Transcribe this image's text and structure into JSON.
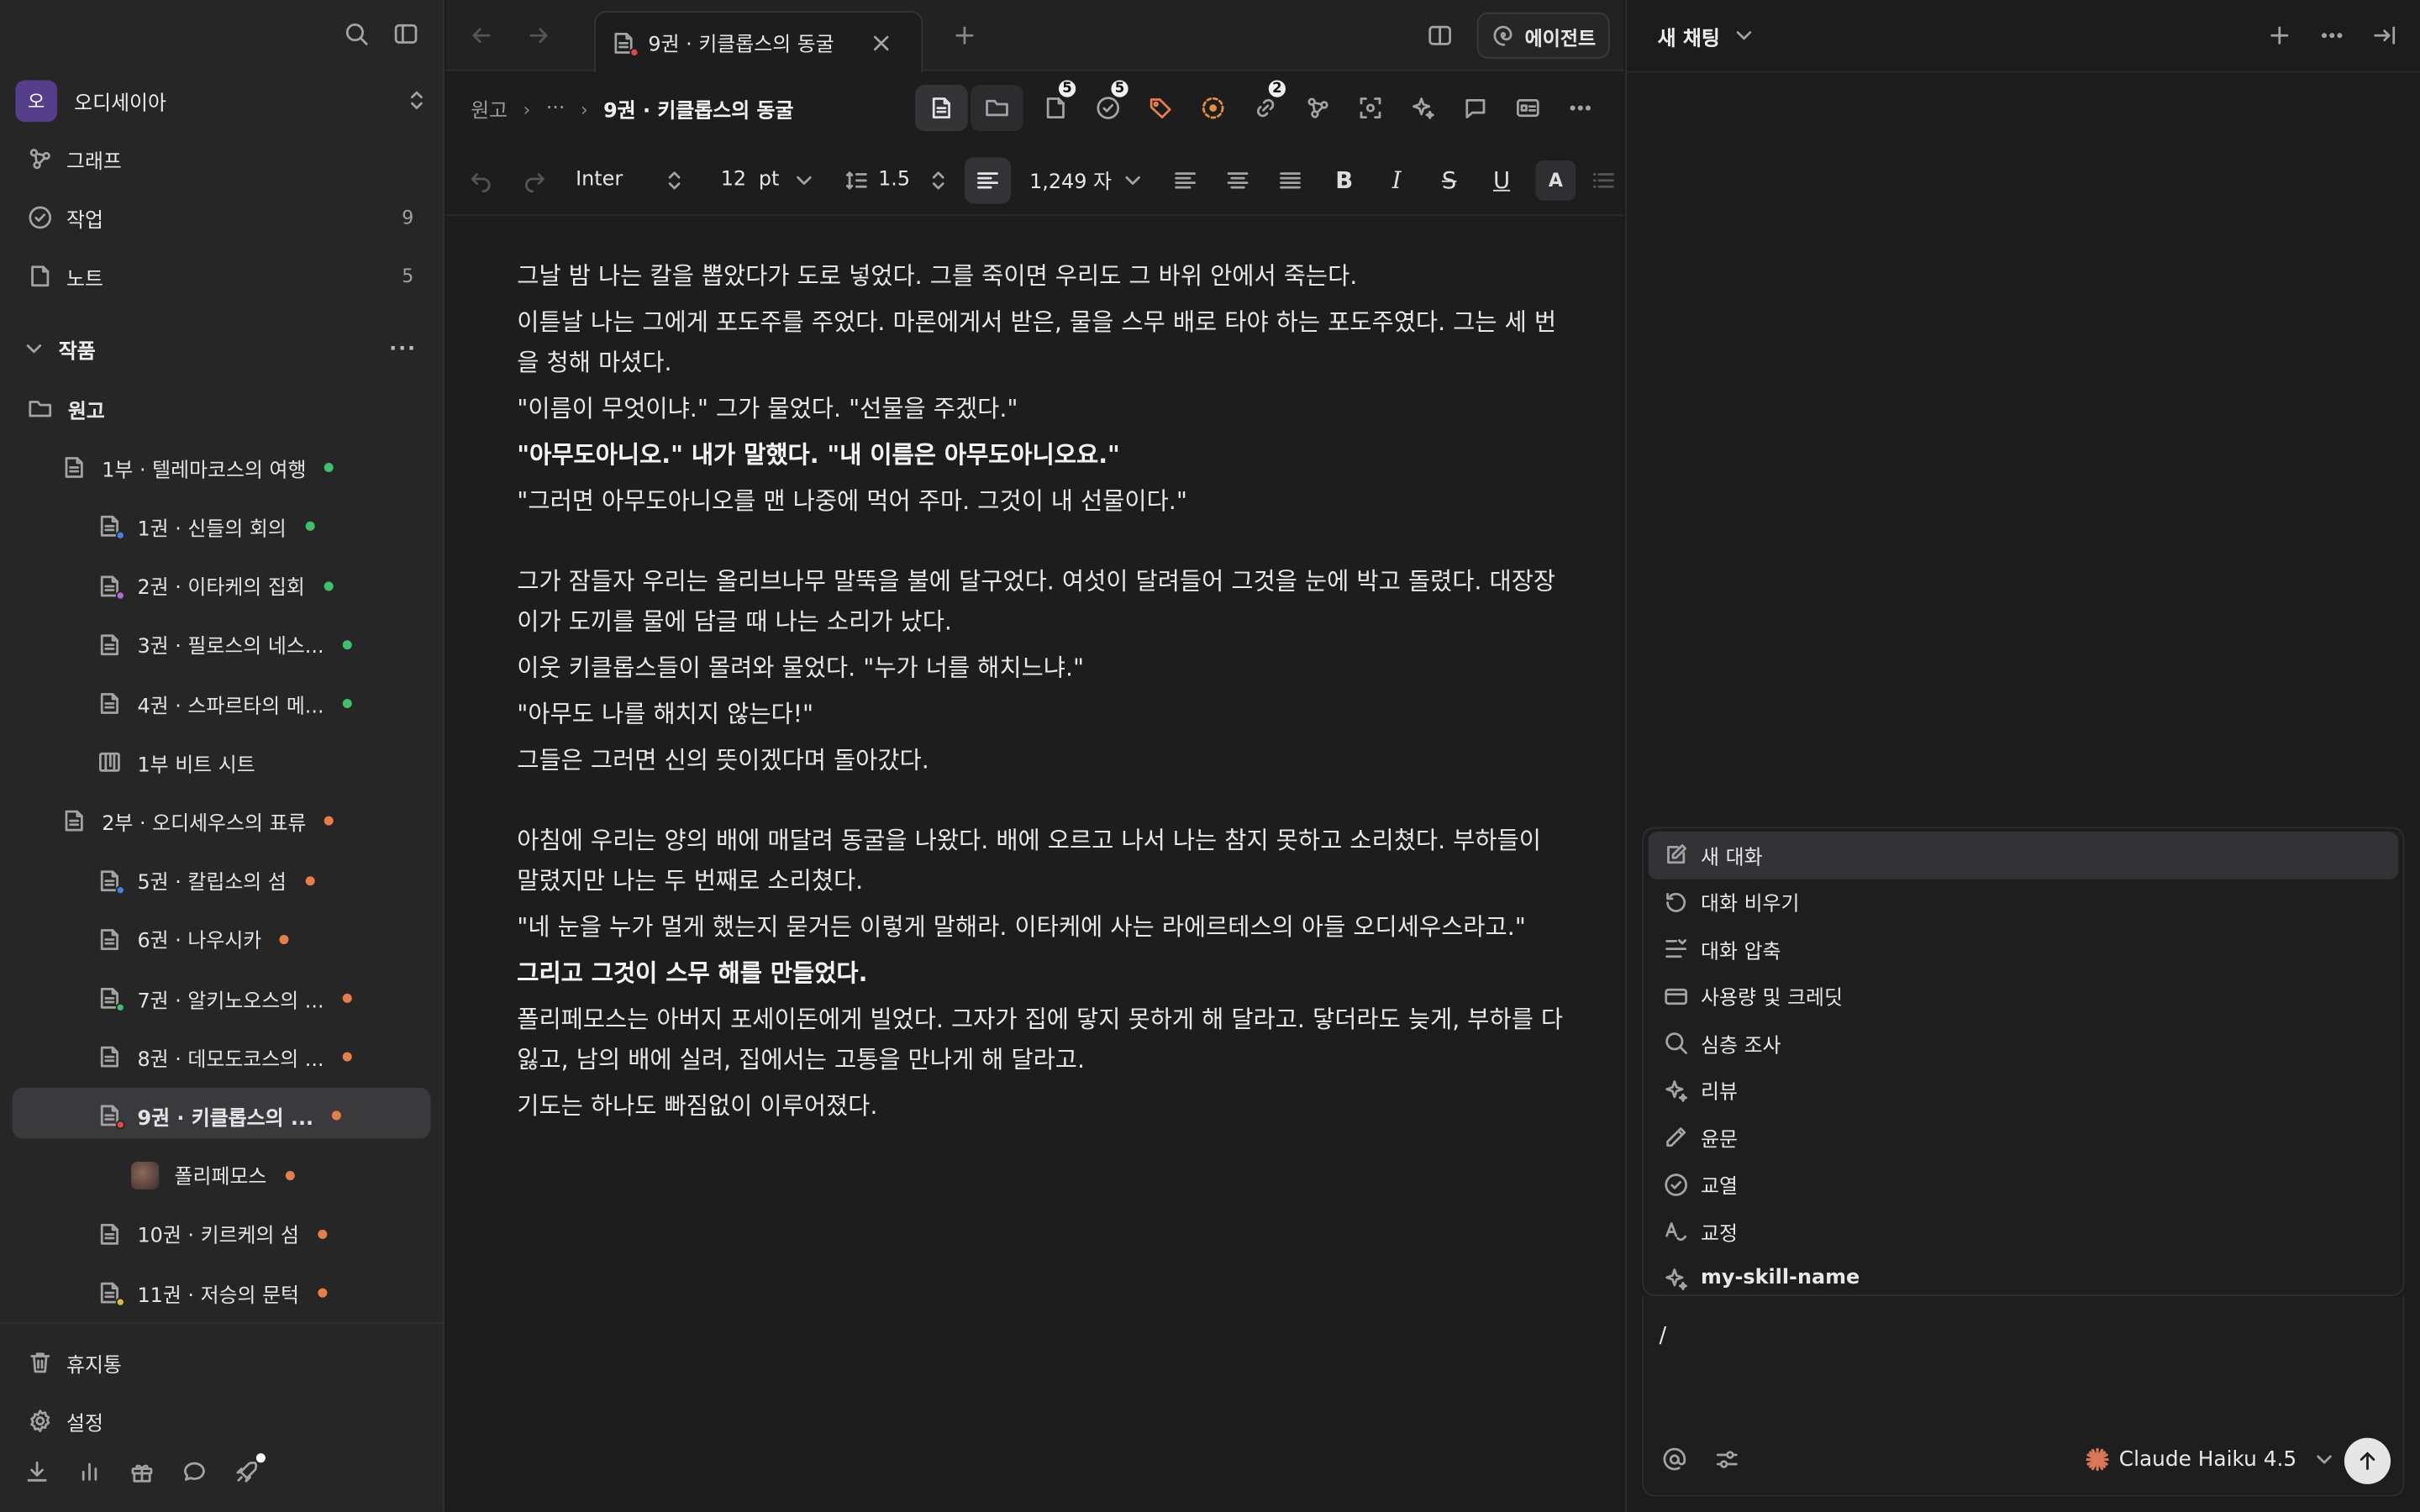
{
  "sidebar": {
    "vault": {
      "avatar": "오",
      "name": "오디세이아"
    },
    "nav": [
      {
        "label": "그래프",
        "count": ""
      },
      {
        "label": "작업",
        "count": "9"
      },
      {
        "label": "노트",
        "count": "5"
      }
    ],
    "section_title": "작품",
    "section_more": "···",
    "tree": [
      {
        "label": "원고",
        "level": 0
      },
      {
        "label": "1부 · 텔레마코스의 여행",
        "level": 1,
        "dot": "#3fbf6a"
      },
      {
        "label": "1권 · 신들의 회의",
        "level": 2,
        "dot": "#3fbf6a",
        "mini": "#4a7de0"
      },
      {
        "label": "2권 · 이타케의 집회",
        "level": 2,
        "dot": "#3fbf6a",
        "mini": "#b46ad8"
      },
      {
        "label": "3권 · 필로스의 네스...",
        "level": 2,
        "dot": "#3fbf6a"
      },
      {
        "label": "4권 · 스파르타의 메...",
        "level": 2,
        "dot": "#3fbf6a"
      },
      {
        "label": "1부 비트 시트",
        "level": 2
      },
      {
        "label": "2부 · 오디세우스의 표류",
        "level": 1,
        "dot": "#e67e4a"
      },
      {
        "label": "5권 · 칼립소의 섬",
        "level": 2,
        "dot": "#e67e4a",
        "mini": "#4a7de0"
      },
      {
        "label": "6권 · 나우시카",
        "level": 2,
        "dot": "#e67e4a"
      },
      {
        "label": "7권 · 알키노오스의 ...",
        "level": 2,
        "dot": "#e67e4a",
        "mini": "#3fbf6a"
      },
      {
        "label": "8권 · 데모도코스의 ...",
        "level": 2,
        "dot": "#e67e4a"
      },
      {
        "label": "9권 · 키클롭스의 ...",
        "level": 2,
        "dot": "#e67e4a",
        "mini": "#e04a4a",
        "active": true
      },
      {
        "label": "폴리페모스",
        "level": 3,
        "dot": "#e67e4a"
      },
      {
        "label": "10권 · 키르케의 섬",
        "level": 2,
        "dot": "#e67e4a"
      },
      {
        "label": "11권 · 저승의 문턱",
        "level": 2,
        "dot": "#e67e4a",
        "mini": "#e0b84a"
      }
    ],
    "trash": "휴지통",
    "settings": "설정"
  },
  "tab": {
    "title": "9권 · 키클롭스의 동굴"
  },
  "breadcrumb": {
    "root": "원고",
    "ellipsis": "···",
    "current": "9권 · 키클롭스의 동굴"
  },
  "badges": {
    "docs": "5",
    "tasks": "5",
    "links": "2"
  },
  "agent_button": "에이전트",
  "format": {
    "font": "Inter",
    "size": "12",
    "unit": "pt",
    "line_height": "1.5",
    "word_count": "1,249 자"
  },
  "editor": {
    "paragraphs": [
      {
        "text": "그날 밤 나는 칼을 뽑았다가 도로 넣었다. 그를 죽이면 우리도 그 바위 안에서 죽는다."
      },
      {
        "text": "이튿날 나는 그에게 포도주를 주었다. 마론에게서 받은, 물을 스무 배로 타야 하는 포도주였다. 그는 세 번을 청해 마셨다."
      },
      {
        "text": "\"이름이 무엇이냐.\" 그가 물었다. \"선물을 주겠다.\""
      },
      {
        "text": "\"아무도아니오.\" 내가 말했다. \"내 이름은 아무도아니오요.\"",
        "bold": true
      },
      {
        "text": "\"그러면 아무도아니오를 맨 나중에 먹어 주마. 그것이 내 선물이다.\""
      },
      {
        "text": "그가 잠들자 우리는 올리브나무 말뚝을 불에 달구었다. 여섯이 달려들어 그것을 눈에 박고 돌렸다. 대장장이가 도끼를 물에 담글 때 나는 소리가 났다.",
        "gap": true
      },
      {
        "text": "이웃 키클롭스들이 몰려와 물었다. \"누가 너를 해치느냐.\""
      },
      {
        "text": "\"아무도 나를 해치지 않는다!\""
      },
      {
        "text": "그들은 그러면 신의 뜻이겠다며 돌아갔다."
      },
      {
        "text": "아침에 우리는 양의 배에 매달려 동굴을 나왔다. 배에 오르고 나서 나는 참지 못하고 소리쳤다. 부하들이 말렸지만 나는 두 번째로 소리쳤다.",
        "gap": true
      },
      {
        "text": "\"네 눈을 누가 멀게 했는지 묻거든 이렇게 말해라. 이타케에 사는 라에르테스의 아들 오디세우스라고.\""
      },
      {
        "text": "그리고 그것이 스무 해를 만들었다.",
        "bold": true
      },
      {
        "text": "폴리페모스는 아버지 포세이돈에게 빌었다. 그자가 집에 닿지 못하게 해 달라고. 닿더라도 늦게, 부하를 다 잃고, 남의 배에 실려, 집에서는 고통을 만나게 해 달라고."
      },
      {
        "text": "기도는 하나도 빠짐없이 이루어졌다."
      }
    ]
  },
  "chat": {
    "title": "새 채팅",
    "menu": [
      {
        "label": "새 대화",
        "icon": "edit-icon",
        "highlighted": true
      },
      {
        "label": "대화 비우기",
        "icon": "rotate-icon"
      },
      {
        "label": "대화 압축",
        "icon": "compress-icon"
      },
      {
        "label": "사용량 및 크레딧",
        "icon": "card-icon"
      },
      {
        "label": "심층 조사",
        "icon": "search-icon"
      },
      {
        "label": "리뷰",
        "icon": "sparkle-icon"
      },
      {
        "label": "윤문",
        "icon": "pen-icon"
      },
      {
        "label": "교열",
        "icon": "check-circle-icon"
      },
      {
        "label": "교정",
        "icon": "spell-icon"
      },
      {
        "label": "my-skill-name",
        "icon": "sparkle-icon"
      }
    ],
    "input_value": "/",
    "model": "Claude Haiku 4.5",
    "accent": "#d97757"
  }
}
